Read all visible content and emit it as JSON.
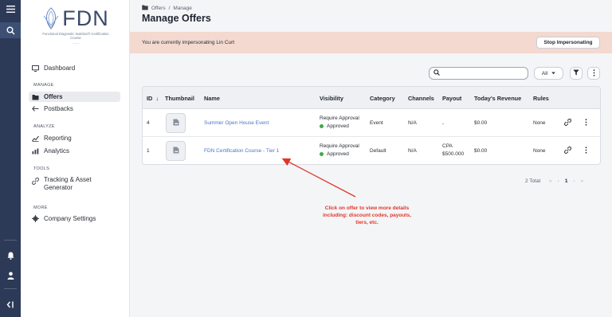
{
  "rail": {
    "menu_icon": "hamburger-icon",
    "search_icon": "search-icon",
    "bell_icon": "bell-icon",
    "user_icon": "user-icon",
    "collapse_icon": "collapse-sidebar-icon"
  },
  "brand": {
    "name": "FDN",
    "tagline": "Functional Diagnostic Nutrition® Certification Course"
  },
  "nav": {
    "dashboard": "Dashboard",
    "manage_label": "MANAGE",
    "offers": "Offers",
    "postbacks": "Postbacks",
    "analyze_label": "ANALYZE",
    "reporting": "Reporting",
    "analytics": "Analytics",
    "tools_label": "TOOLS",
    "tracking": "Tracking & Asset Generator",
    "more_label": "MORE",
    "company_settings": "Company Settings"
  },
  "breadcrumb": {
    "part1": "Offers",
    "sep": "/",
    "part2": "Manage"
  },
  "page_title": "Manage Offers",
  "banner": {
    "message": "You are currently impersonating Lin Curt",
    "button": "Stop Impersonating",
    "background": "#f3d9cf"
  },
  "toolbar": {
    "search_placeholder": "",
    "filter_value": "All"
  },
  "table": {
    "headers": {
      "id": "ID",
      "thumbnail": "Thumbnail",
      "name": "Name",
      "visibility": "Visibility",
      "category": "Category",
      "channels": "Channels",
      "payout": "Payout",
      "revenue": "Today's Revenue",
      "rules": "Rules"
    },
    "rows": [
      {
        "id": "4",
        "name": "Summer Open House Event",
        "visibility": "Require Approval",
        "status": "Approved",
        "category": "Event",
        "channels": "N/A",
        "payout_type": "-",
        "payout_amount": "",
        "revenue": "$0.00",
        "rules": "None"
      },
      {
        "id": "1",
        "name": "FDN Certification Course - Tier 1",
        "visibility": "Require Approval",
        "status": "Approved",
        "category": "Default",
        "channels": "N/A",
        "payout_type": "CPA",
        "payout_amount": "$500.000",
        "revenue": "$0.00",
        "rules": "None"
      }
    ]
  },
  "pagination": {
    "total": "2 Total",
    "first": "«",
    "prev": "‹",
    "current": "1",
    "next": "›",
    "last": "»"
  },
  "annotation": {
    "text": "Click on offer to view more details including: discount codes, payouts, tiers, etc.",
    "color": "#e0362a"
  },
  "colors": {
    "rail": "#2c3a57",
    "link": "#4a74c9",
    "approved": "#3fa94a"
  }
}
